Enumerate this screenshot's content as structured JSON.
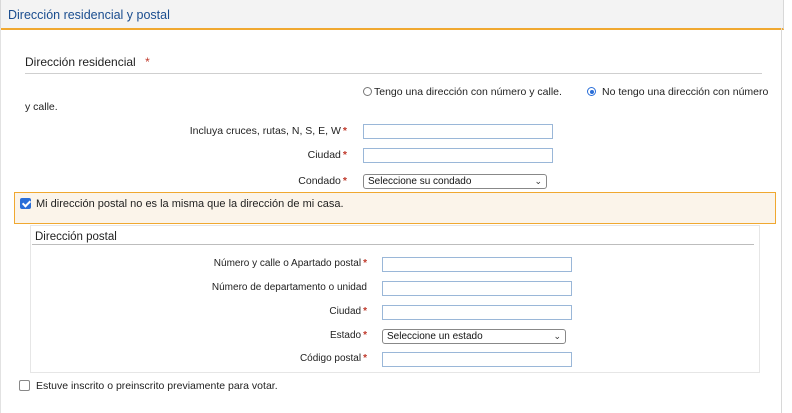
{
  "section": {
    "title": "Dirección residencial y postal"
  },
  "residential": {
    "heading": "Dirección residencial",
    "required_mark": "*",
    "radio_with_street_label": "Tengo una dirección con número y calle.",
    "radio_without_street_label": "No tengo una dirección con número",
    "radio_without_street_wrap": "y calle.",
    "selected_option": "no-street",
    "fields": {
      "cross_streets_label": "Incluya cruces, rutas, N, S, E, W",
      "city_label": "Ciudad",
      "county_label": "Condado",
      "county_selected": "Seleccione su condado"
    }
  },
  "mailing_toggle": {
    "label": "Mi dirección postal no es la misma que la dirección de mi casa.",
    "checked": true
  },
  "postal": {
    "heading": "Dirección postal",
    "fields": {
      "street_label": "Número y calle o Apartado postal",
      "unit_label": "Número de departamento o unidad",
      "city_label": "Ciudad",
      "state_label": "Estado",
      "state_selected": "Seleccione un estado",
      "zip_label": "Código postal"
    }
  },
  "previous_registration": {
    "label": "Estuve inscrito o preinscrito previamente para votar.",
    "checked": false
  },
  "star": "*",
  "colors": {
    "accent": "#f0a830",
    "link": "#1a4d8f",
    "required": "#c0392b",
    "control": "#2a6ed8"
  }
}
